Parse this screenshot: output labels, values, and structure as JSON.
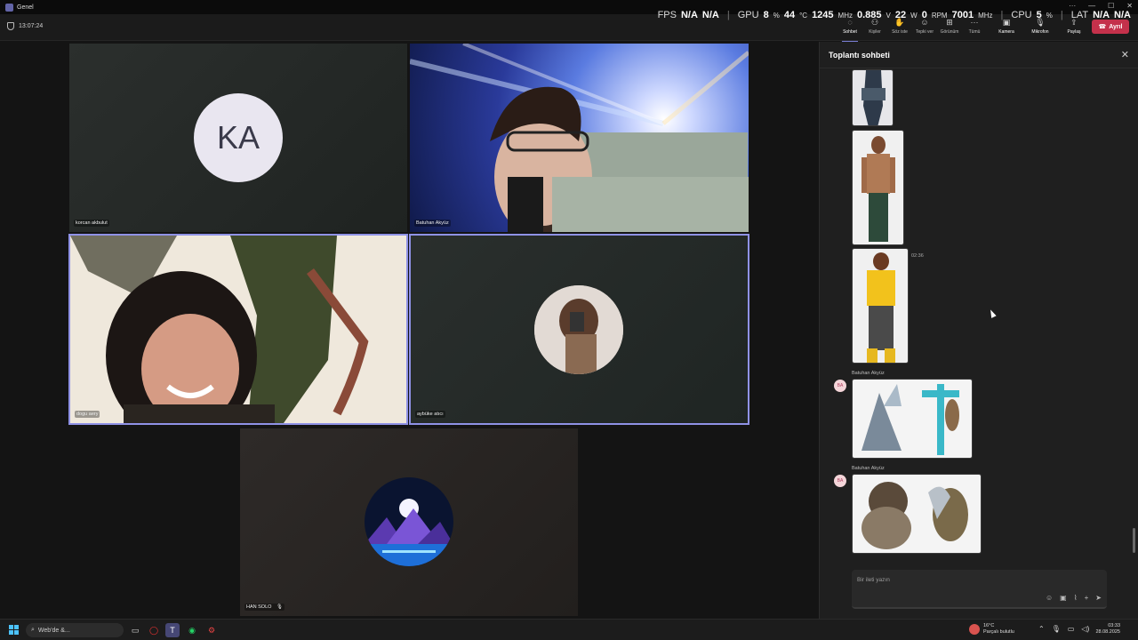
{
  "window": {
    "title": "Genel"
  },
  "window_controls": {
    "more": "···",
    "minimize": "—",
    "maximize": "☐",
    "close": "✕"
  },
  "perf_overlay": {
    "fps_label": "FPS",
    "fps_value": "N/A",
    "fps_value2": "N/A",
    "gpu_label": "GPU",
    "gpu_pct": "8",
    "gpu_temp": "44",
    "gpu_clock": "1245",
    "gpu_volt": "0.885",
    "gpu_watt": "22",
    "gpu_rpm": "0",
    "gpu_mem": "7001",
    "unit_pct": "%",
    "unit_c": "°C",
    "unit_mhz": "MHz",
    "unit_v": "V",
    "unit_w": "W",
    "unit_rpm": "RPM",
    "cpu_label": "CPU",
    "cpu_pct": "5",
    "lat_label": "LAT",
    "lat_value": "N/A",
    "lat_value2": "N/A"
  },
  "toolbar": {
    "timer": "13:07:24",
    "chat": "Sohbet",
    "people": "Kişiler",
    "raise_hand": "Söz iste",
    "react": "Tepki ver",
    "view": "Görünüm",
    "more": "Tümü",
    "camera": "Kamera",
    "mic": "Mikrofon",
    "share": "Paylaş",
    "leave": "Ayrıl"
  },
  "participants": [
    {
      "name": "korcan akbulut",
      "initials": "KA"
    },
    {
      "name": "Batuhan Akyüz"
    },
    {
      "name": "dogu aery"
    },
    {
      "name": "aybüke atıcı"
    },
    {
      "name": "HAN SOLO"
    }
  ],
  "chat": {
    "title": "Toplantı sohbeti",
    "timestamp": "02:36",
    "messages": [
      {
        "sender": "Batuhan Akyüz",
        "avatar": "BA"
      },
      {
        "sender": "Batuhan Akyüz",
        "avatar": "BA"
      }
    ],
    "composer_placeholder": "Bir ileti yazın"
  },
  "taskbar": {
    "search_placeholder": "Web'de &...",
    "weather_temp": "16°C",
    "weather_desc": "Parçalı bulutlu",
    "time": "03:33",
    "date": "28.08.2025"
  },
  "colors": {
    "accent": "#7b7fd6",
    "leave": "#c4314b",
    "selected_border": "#8f92e6"
  },
  "icons": [
    "shield-icon",
    "chat-icon",
    "people-icon",
    "hand-icon",
    "emoji-icon",
    "grid-icon",
    "more-icon",
    "camera-icon",
    "mic-icon",
    "share-icon",
    "phone-icon",
    "close-icon",
    "send-icon",
    "attach-icon",
    "plus-icon",
    "windows-icon",
    "search-icon"
  ]
}
